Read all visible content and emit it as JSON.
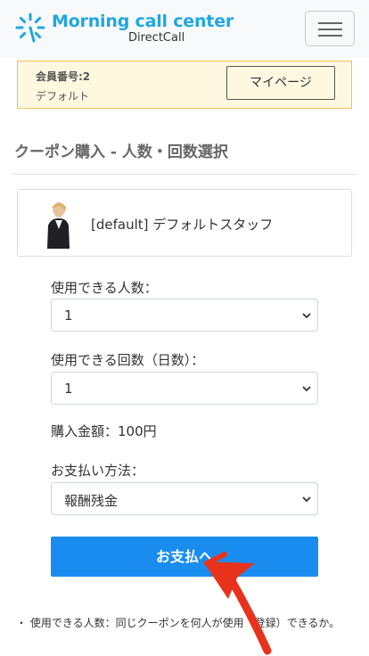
{
  "header": {
    "logo_title": "Morning call center",
    "logo_subtitle": "DirectCall",
    "menu_icon": "hamburger-menu-icon",
    "brand_color": "#1fa7e0"
  },
  "member": {
    "number": "会員番号:2",
    "name": "デフォルト",
    "mypage_label": "マイページ"
  },
  "page": {
    "title": "クーポン購入 - 人数・回数選択"
  },
  "staff": {
    "name": "[default] デフォルトスタッフ"
  },
  "form": {
    "people_label": "使用できる人数：",
    "people_value": "1",
    "times_label": "使用できる回数（日数）：",
    "times_value": "1",
    "price_text": "購入金額：100円",
    "payment_label": "お支払い方法：",
    "payment_value": "報酬残金",
    "pay_button": "お支払へ",
    "accent_color": "#1a8cf0"
  },
  "notes": {
    "line1": "・ 使用できる人数：同じクーポンを何人が使用（登録）できるか。"
  }
}
